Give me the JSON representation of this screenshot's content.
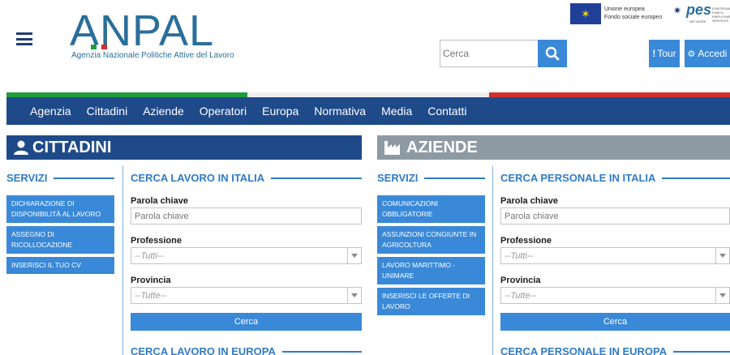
{
  "header": {
    "logo_text": "ANPAL",
    "logo_subtitle": "Agenzia Nazionale Politiche Attive del Lavoro",
    "eu_line1": "Unione europea",
    "eu_line2": "Fondo sociale europeo",
    "pes_text": "pes",
    "pes_small": "EUROPEAN PUBLIC EMPLOYMENT SERVICES",
    "pes_sub": "NETWORK",
    "search_placeholder": "Cerca",
    "tour_label": "Tour",
    "login_label": "Accedi"
  },
  "colors": {
    "primary": "#1f4a8a",
    "accent": "#3a89d8",
    "grey_header": "#8e9aa3",
    "green": "#1f9d3c",
    "red": "#d32f2f"
  },
  "nav": [
    "Agenzia",
    "Cittadini",
    "Aziende",
    "Operatori",
    "Europa",
    "Normativa",
    "Media",
    "Contatti"
  ],
  "cittadini": {
    "title": "CITTADINI",
    "servizi_title": "SERVIZI",
    "servizi": [
      "DICHIARAZIONE DI DISPONIBILITÀ AL LAVORO",
      "ASSEGNO DI RICOLLOCAZIONE",
      "INSERISCI IL TUO CV"
    ],
    "form_title": "CERCA LAVORO IN ITALIA",
    "keyword_label": "Parola chiave",
    "keyword_placeholder": "Parola chiave",
    "profession_label": "Professione",
    "profession_value": "--Tutti--",
    "province_label": "Provincia",
    "province_value": "--Tutte--",
    "search_button": "Cerca",
    "next_title": "CERCA LAVORO IN EUROPA"
  },
  "aziende": {
    "title": "AZIENDE",
    "servizi_title": "SERVIZI",
    "servizi": [
      "COMUNICAZIONI OBBLIGATORIE",
      "ASSUNZIONI CONGIUNTE IN AGRICOLTURA",
      "LAVORO MARITTIMO - UNIMARE",
      "INSERISCI LE OFFERTE DI LAVORO"
    ],
    "form_title": "CERCA PERSONALE IN ITALIA",
    "keyword_label": "Parola chiave",
    "keyword_placeholder": "Parola chiave",
    "profession_label": "Professione",
    "profession_value": "--Tutti--",
    "province_label": "Provincia",
    "province_value": "--Tutte--",
    "search_button": "Cerca",
    "next_title": "CERCA PERSONALE IN EUROPA"
  }
}
